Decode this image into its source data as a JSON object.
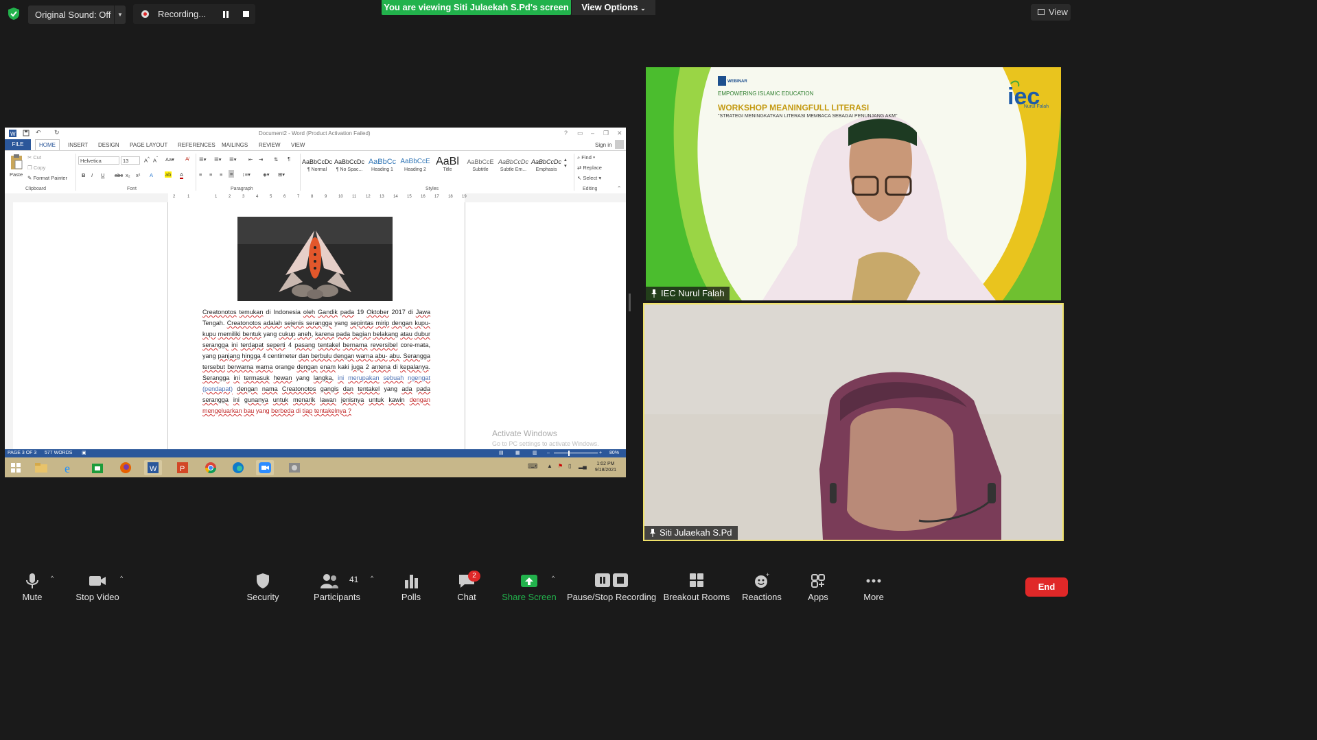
{
  "top_bar": {
    "original_sound": "Original Sound: Off",
    "recording": "Recording...",
    "viewing_banner": "You are viewing Siti Julaekah S.Pd's screen",
    "view_options": "View Options",
    "view": "View"
  },
  "word": {
    "window_title": "Document2 - Word (Product Activation Failed)",
    "sign_in": "Sign in",
    "tabs": [
      "FILE",
      "HOME",
      "INSERT",
      "DESIGN",
      "PAGE LAYOUT",
      "REFERENCES",
      "MAILINGS",
      "REVIEW",
      "VIEW"
    ],
    "clipboard": {
      "paste": "Paste",
      "cut": "Cut",
      "copy": "Copy",
      "format_painter": "Format Painter",
      "group": "Clipboard"
    },
    "font": {
      "name": "Helvetica",
      "size": "13",
      "group": "Font"
    },
    "paragraph_group": "Paragraph",
    "styles": [
      {
        "preview": "AaBbCcDc",
        "name": "¶ Normal"
      },
      {
        "preview": "AaBbCcDc",
        "name": "¶ No Spac..."
      },
      {
        "preview": "AaBbCc",
        "name": "Heading 1"
      },
      {
        "preview": "AaBbCcE",
        "name": "Heading 2"
      },
      {
        "preview": "AaBl",
        "name": "Title"
      },
      {
        "preview": "AaBbCcE",
        "name": "Subtitle"
      },
      {
        "preview": "AaBbCcDc",
        "name": "Subtle Em..."
      },
      {
        "preview": "AaBbCcDc",
        "name": "Emphasis"
      }
    ],
    "styles_group": "Styles",
    "editing": {
      "find": "Find",
      "replace": "Replace",
      "select": "Select",
      "group": "Editing"
    },
    "ruler_numbers": [
      "2",
      "1",
      "1",
      "2",
      "3",
      "4",
      "5",
      "6",
      "7",
      "8",
      "9",
      "10",
      "11",
      "12",
      "13",
      "14",
      "15",
      "16",
      "17",
      "18",
      "19"
    ],
    "document_text": [
      {
        "t": "Creatonotos",
        "c": "sp"
      },
      {
        "t": " "
      },
      {
        "t": "temukan",
        "c": "sp"
      },
      {
        "t": " di Indonesia "
      },
      {
        "t": "oleh",
        "c": "sp"
      },
      {
        "t": " "
      },
      {
        "t": "Gandik",
        "c": "sp"
      },
      {
        "t": " "
      },
      {
        "t": "pada",
        "c": "sp"
      },
      {
        "t": " 19 "
      },
      {
        "t": "Oktober",
        "c": "sp"
      },
      {
        "t": " 2017 di "
      },
      {
        "t": "Jawa",
        "c": "sp"
      },
      {
        "t": " Tengah. "
      },
      {
        "t": "Creatonotos",
        "c": "sp"
      },
      {
        "t": " "
      },
      {
        "t": "adalah",
        "c": "sp"
      },
      {
        "t": " "
      },
      {
        "t": "sejenis",
        "c": "sp"
      },
      {
        "t": " "
      },
      {
        "t": "serangga",
        "c": "sp"
      },
      {
        "t": " yang "
      },
      {
        "t": "sepintas",
        "c": "sp"
      },
      {
        "t": " "
      },
      {
        "t": "mirip",
        "c": "sp"
      },
      {
        "t": " "
      },
      {
        "t": "dengan",
        "c": "sp"
      },
      {
        "t": " "
      },
      {
        "t": "kupu-kupu",
        "c": "sp"
      },
      {
        "t": " "
      },
      {
        "t": "memiliki",
        "c": "sp"
      },
      {
        "t": " "
      },
      {
        "t": "bentuk",
        "c": "sp"
      },
      {
        "t": " yang "
      },
      {
        "t": "cukup",
        "c": "sp"
      },
      {
        "t": " "
      },
      {
        "t": "aneh",
        "c": "sp"
      },
      {
        "t": ", "
      },
      {
        "t": "karena",
        "c": "sp"
      },
      {
        "t": " "
      },
      {
        "t": "pada",
        "c": "sp"
      },
      {
        "t": " "
      },
      {
        "t": "bagian",
        "c": "sp"
      },
      {
        "t": " "
      },
      {
        "t": "belakang",
        "c": "sp"
      },
      {
        "t": " "
      },
      {
        "t": "atau",
        "c": "sp"
      },
      {
        "t": " "
      },
      {
        "t": "dubur",
        "c": "sp"
      },
      {
        "t": " "
      },
      {
        "t": "serangga",
        "c": "sp"
      },
      {
        "t": " "
      },
      {
        "t": "ini",
        "c": "sp"
      },
      {
        "t": " "
      },
      {
        "t": "terdapat",
        "c": "sp"
      },
      {
        "t": " "
      },
      {
        "t": "seperti",
        "c": "sp"
      },
      {
        "t": " 4 "
      },
      {
        "t": "pasang",
        "c": "sp"
      },
      {
        "t": " "
      },
      {
        "t": "tentakel",
        "c": "sp"
      },
      {
        "t": " "
      },
      {
        "t": "bernama",
        "c": "sp"
      },
      {
        "t": " "
      },
      {
        "t": "reversibel",
        "c": "sp"
      },
      {
        "t": " core-mata, yang "
      },
      {
        "t": "panjang",
        "c": "sp"
      },
      {
        "t": " "
      },
      {
        "t": "hingga",
        "c": "sp"
      },
      {
        "t": " 4 centimeter "
      },
      {
        "t": "dan",
        "c": "sp"
      },
      {
        "t": " "
      },
      {
        "t": "berbulu",
        "c": "sp"
      },
      {
        "t": " "
      },
      {
        "t": "dengan",
        "c": "sp"
      },
      {
        "t": " "
      },
      {
        "t": "warna",
        "c": "sp"
      },
      {
        "t": " "
      },
      {
        "t": "abu-",
        "c": "sp"
      },
      {
        "t": " "
      },
      {
        "t": "abu",
        "c": "sp"
      },
      {
        "t": ". "
      },
      {
        "t": "Serangga",
        "c": "sp"
      },
      {
        "t": " "
      },
      {
        "t": "tersebut",
        "c": "sp"
      },
      {
        "t": " "
      },
      {
        "t": "berwarna",
        "c": "sp"
      },
      {
        "t": " "
      },
      {
        "t": "warna",
        "c": "sp"
      },
      {
        "t": " orange "
      },
      {
        "t": "dengan",
        "c": "sp"
      },
      {
        "t": " "
      },
      {
        "t": "enam",
        "c": "sp"
      },
      {
        "t": " kaki "
      },
      {
        "t": "juga",
        "c": "sp"
      },
      {
        "t": " 2 "
      },
      {
        "t": "antena",
        "c": "sp"
      },
      {
        "t": " di "
      },
      {
        "t": "kepalanya",
        "c": "sp"
      },
      {
        "t": ". "
      },
      {
        "t": "Serangga",
        "c": "sp"
      },
      {
        "t": " "
      },
      {
        "t": "ini",
        "c": "sp"
      },
      {
        "t": " "
      },
      {
        "t": "termasuk",
        "c": "sp"
      },
      {
        "t": " "
      },
      {
        "t": "hewan",
        "c": "sp"
      },
      {
        "t": " yang "
      },
      {
        "t": "langka",
        "c": "sp"
      },
      {
        "t": ", "
      },
      {
        "t": "ini",
        "c": "sp bl"
      },
      {
        "t": " "
      },
      {
        "t": "merupakan",
        "c": "sp bl"
      },
      {
        "t": " "
      },
      {
        "t": "sebuah",
        "c": "sp bl"
      },
      {
        "t": " "
      },
      {
        "t": "ngengat",
        "c": "sp bl"
      },
      {
        "t": " "
      },
      {
        "t": "(pendapat)",
        "c": "sp bl"
      },
      {
        "t": " "
      },
      {
        "t": "dengan",
        "c": "sp"
      },
      {
        "t": " "
      },
      {
        "t": "nama",
        "c": "sp"
      },
      {
        "t": " "
      },
      {
        "t": "Creatonotos",
        "c": "sp"
      },
      {
        "t": " "
      },
      {
        "t": "gangis",
        "c": "sp"
      },
      {
        "t": " "
      },
      {
        "t": "dan",
        "c": "sp"
      },
      {
        "t": " "
      },
      {
        "t": "tentakel",
        "c": "sp"
      },
      {
        "t": " yang "
      },
      {
        "t": "ada",
        "c": "sp"
      },
      {
        "t": " "
      },
      {
        "t": "pada",
        "c": "sp"
      },
      {
        "t": " "
      },
      {
        "t": "serangga",
        "c": "sp"
      },
      {
        "t": " "
      },
      {
        "t": "ini",
        "c": "sp"
      },
      {
        "t": " "
      },
      {
        "t": "gunanya",
        "c": "sp"
      },
      {
        "t": " "
      },
      {
        "t": "untuk",
        "c": "sp"
      },
      {
        "t": " "
      },
      {
        "t": "menarik",
        "c": "sp"
      },
      {
        "t": " "
      },
      {
        "t": "lawan",
        "c": "sp"
      },
      {
        "t": " "
      },
      {
        "t": "jenisnya",
        "c": "sp"
      },
      {
        "t": " "
      },
      {
        "t": "untuk",
        "c": "sp"
      },
      {
        "t": " "
      },
      {
        "t": "kawin",
        "c": "sp"
      },
      {
        "t": " "
      },
      {
        "t": "dengan",
        "c": "sp rd"
      },
      {
        "t": " "
      },
      {
        "t": "mengeluarkan",
        "c": "sp rd"
      },
      {
        "t": " "
      },
      {
        "t": "bau",
        "c": "sp rd"
      },
      {
        "t": " yang ",
        "c": "rd"
      },
      {
        "t": "berbeda",
        "c": "sp rd"
      },
      {
        "t": " di ",
        "c": "rd"
      },
      {
        "t": "tiap",
        "c": "sp rd"
      },
      {
        "t": " ",
        "c": "rd"
      },
      {
        "t": "tentakelnya",
        "c": "sp rd"
      },
      {
        "t": " ?",
        "c": "sp rd"
      }
    ],
    "watermark_1": "Activate Windows",
    "watermark_2": "Go to PC settings to activate Windows.",
    "status_page": "PAGE 3 OF 3",
    "status_words": "577 WORDS",
    "zoom": "80%",
    "clock_time": "1:02 PM",
    "clock_date": "9/18/2021"
  },
  "tile1": {
    "name": "IEC Nurul Falah",
    "slide_web": "WEBINAR",
    "slide_line1": "EMPOWERING ISLAMIC EDUCATION",
    "slide_line2": "WORKSHOP MEANINGFULL LITERASI",
    "slide_line3": "\"STRATEGI MENINGKATKAN LITERASI MEMBACA SEBAGAI PENUNJANG AKM\"",
    "logo_text": "iec",
    "logo_sub": "Nurul Falah"
  },
  "tile2": {
    "name": "Siti Julaekah S.Pd"
  },
  "toolbar": {
    "mute": "Mute",
    "stop_video": "Stop Video",
    "security": "Security",
    "participants": "Participants",
    "participants_count": "41",
    "polls": "Polls",
    "chat": "Chat",
    "chat_badge": "2",
    "share_screen": "Share Screen",
    "pause_stop_recording": "Pause/Stop Recording",
    "breakout_rooms": "Breakout Rooms",
    "reactions": "Reactions",
    "apps": "Apps",
    "more": "More",
    "end": "End"
  },
  "colors": {
    "accent_green": "#22b24c",
    "end_red": "#e02828",
    "word_blue": "#2b579a",
    "active_border": "#f0e26a"
  }
}
